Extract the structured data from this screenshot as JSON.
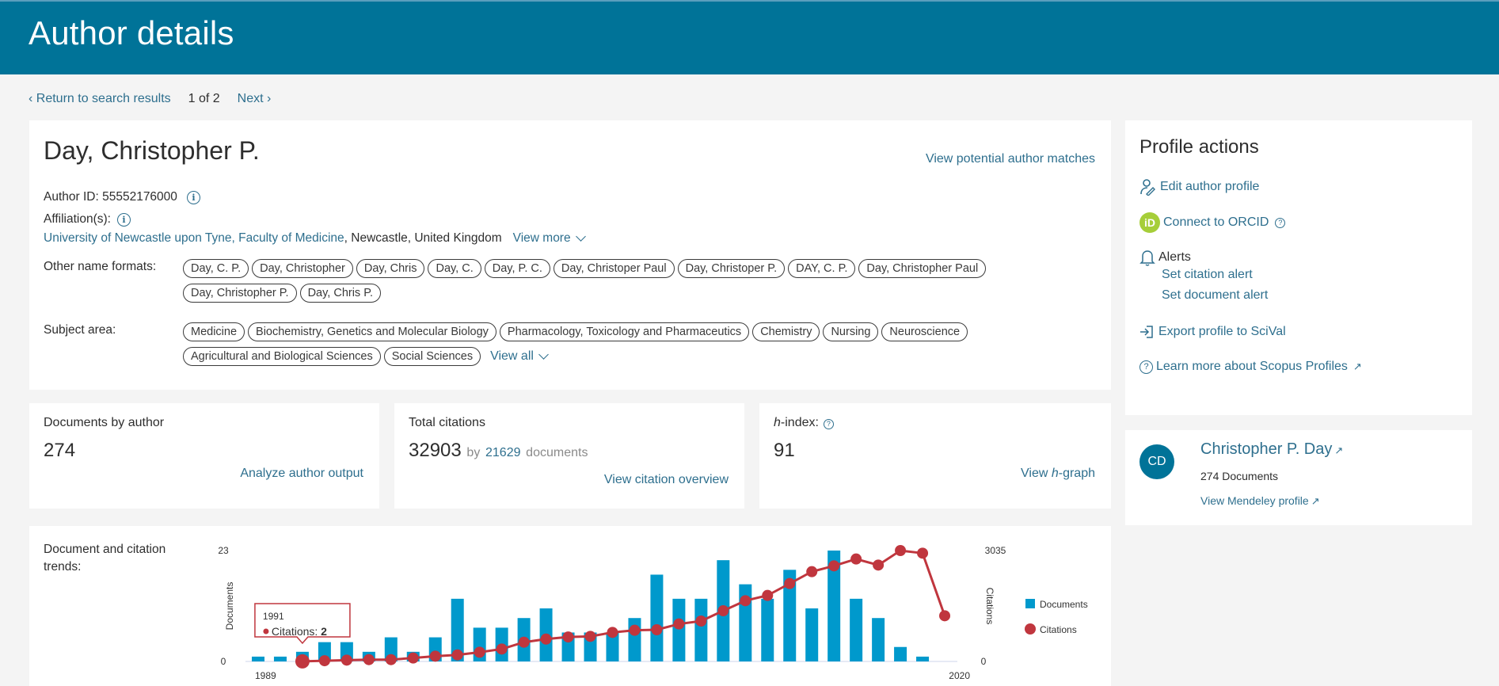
{
  "header": {
    "title": "Author details"
  },
  "nav": {
    "back_label": "Return to search results",
    "position": "1 of 2",
    "next_label": "Next"
  },
  "author": {
    "name": "Day, Christopher P.",
    "view_matches": "View potential author matches",
    "author_id_label": "Author ID:",
    "author_id": "55552176000",
    "affiliation_label": "Affiliation(s):",
    "affiliation_link": "University of Newcastle upon Tyne, Faculty of Medicine",
    "affiliation_rest": ", Newcastle, United Kingdom",
    "view_more": "View more",
    "name_formats_label": "Other name formats:",
    "name_formats": [
      "Day, C. P.",
      "Day, Christopher",
      "Day, Chris",
      "Day, C.",
      "Day, P. C.",
      "Day, Christoper Paul",
      "Day, Christoper P.",
      "DAY, C. P.",
      "Day, Christopher Paul",
      "Day, Christopher P.",
      "Day, Chris P."
    ],
    "subject_label": "Subject area:",
    "subjects": [
      "Medicine",
      "Biochemistry, Genetics and Molecular Biology",
      "Pharmacology, Toxicology and Pharmaceutics",
      "Chemistry",
      "Nursing",
      "Neuroscience",
      "Agricultural and Biological Sciences",
      "Social Sciences"
    ],
    "view_all": "View all"
  },
  "metrics": {
    "documents": {
      "label": "Documents by author",
      "value": "274",
      "action": "Analyze author output"
    },
    "citations": {
      "label": "Total citations",
      "value": "32903",
      "by": "by",
      "doc_count": "21629",
      "doc_word": "documents",
      "action": "View citation overview"
    },
    "hindex": {
      "label_italic": "h",
      "label_rest": "-index:",
      "value": "91",
      "action_pre": "View ",
      "action_italic": "h",
      "action_post": "-graph"
    }
  },
  "trends": {
    "label": "Document and citation trends:"
  },
  "profile_actions": {
    "title": "Profile actions",
    "edit": "Edit author profile",
    "orcid": "Connect to ORCID",
    "orcid_badge": "iD",
    "alerts": "Alerts",
    "citation_alert": "Set citation alert",
    "document_alert": "Set document alert",
    "export": "Export profile to SciVal",
    "learn": "Learn more about Scopus Profiles"
  },
  "mendeley": {
    "initials": "CD",
    "name": "Christopher P. Day",
    "documents": "274 Documents",
    "link": "View Mendeley profile"
  },
  "chart_data": {
    "type": "bar",
    "title": "Document and citation trends",
    "x": [
      1989,
      1990,
      1991,
      1992,
      1993,
      1994,
      1995,
      1996,
      1997,
      1998,
      1999,
      2000,
      2001,
      2002,
      2003,
      2004,
      2005,
      2006,
      2007,
      2008,
      2009,
      2010,
      2011,
      2012,
      2013,
      2014,
      2015,
      2016,
      2017,
      2018,
      2019,
      2020
    ],
    "x_tick_labels": [
      "1989",
      "2020"
    ],
    "series": [
      {
        "name": "Documents",
        "type": "bar",
        "axis": "left",
        "color": "#0099cc",
        "values": [
          1,
          1,
          2,
          4,
          4,
          2,
          5,
          2,
          5,
          13,
          7,
          7,
          9,
          11,
          6,
          6,
          6,
          9,
          18,
          13,
          13,
          21,
          16,
          13,
          19,
          11,
          23,
          13,
          9,
          3,
          1,
          0
        ]
      },
      {
        "name": "Citations",
        "type": "line",
        "axis": "right",
        "color": "#c0363e",
        "values": [
          null,
          null,
          2,
          20,
          36,
          50,
          50,
          94,
          144,
          180,
          252,
          340,
          526,
          612,
          670,
          686,
          795,
          853,
          867,
          1026,
          1106,
          1387,
          1662,
          1807,
          2132,
          2457,
          2616,
          2804,
          2637,
          3035,
          2963,
          1250
        ]
      }
    ],
    "ylabel": "Documents",
    "ylim": [
      0,
      23
    ],
    "y_ticks": [
      "0",
      "23"
    ],
    "y2label": "Citations",
    "y2lim": [
      0,
      3035
    ],
    "y2_ticks": [
      "0",
      "3035"
    ],
    "legend": "right",
    "grid": false,
    "tooltip": {
      "year": "1991",
      "label": "Citations:",
      "value": "2"
    }
  }
}
